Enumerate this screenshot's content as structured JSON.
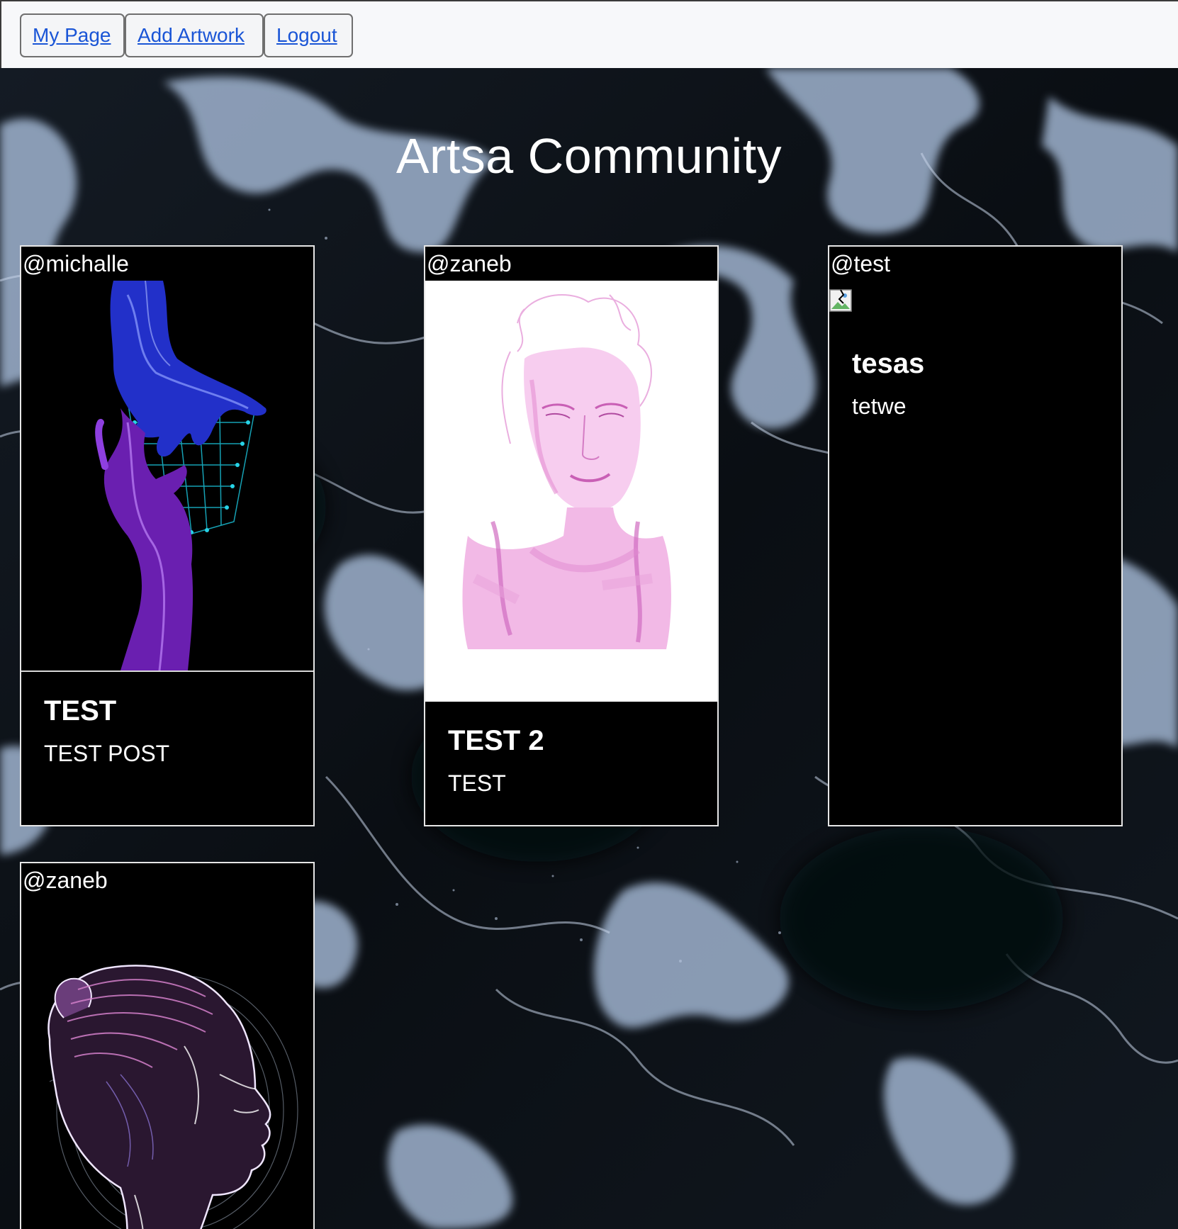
{
  "nav": {
    "my_page": "My Page",
    "add_artwork": "Add Artwork",
    "logout": "Logout",
    "link_color": "#1a55d6"
  },
  "page": {
    "title": "Artsa Community"
  },
  "posts": [
    {
      "author": "@michalle",
      "title": "TEST",
      "description": "TEST POST",
      "image": "hands-circuit-art"
    },
    {
      "author": "@zaneb",
      "title": "TEST 2",
      "description": "TEST",
      "image": "pink-portrait-sketch"
    },
    {
      "author": "@test",
      "title": "tesas",
      "description": "tetwe",
      "image": "broken-image-icon"
    },
    {
      "author": "@zaneb",
      "title": "",
      "description": "",
      "image": "line-art-profile"
    }
  ]
}
